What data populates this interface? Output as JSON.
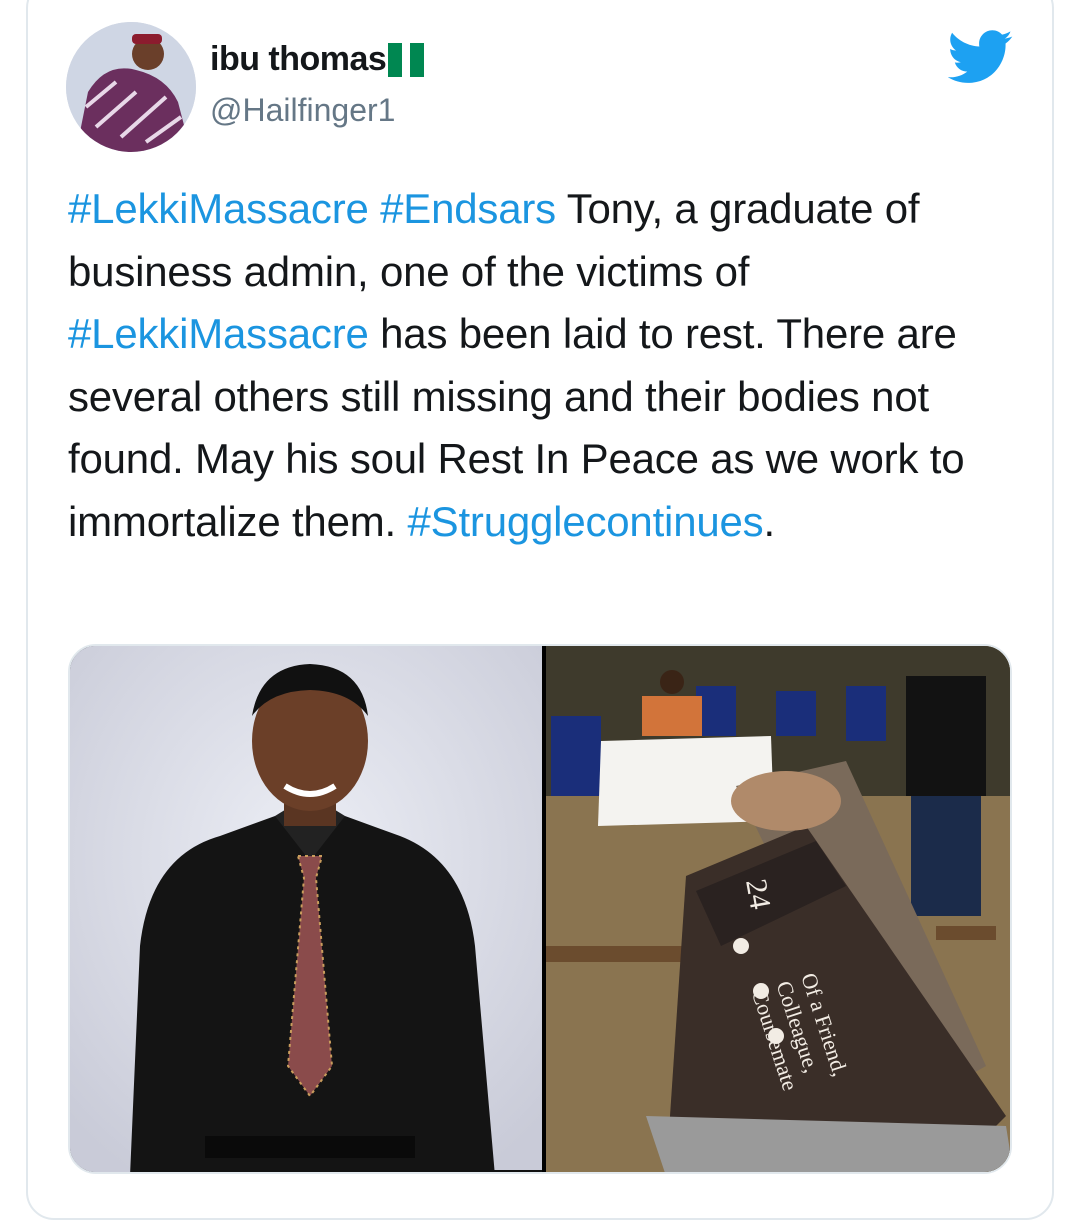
{
  "author": {
    "display_name": "ibu thomas",
    "handle": "@Hailfinger1"
  },
  "icons": {
    "flag": "nigeria-flag-icon",
    "brand": "twitter-bird-icon"
  },
  "tweet": {
    "segments": [
      {
        "text": "#LekkiMassacre",
        "type": "hashtag"
      },
      {
        "text": " ",
        "type": "text"
      },
      {
        "text": "#Endsars",
        "type": "hashtag"
      },
      {
        "text": " Tony, a graduate of business admin, one of the victims of ",
        "type": "text"
      },
      {
        "text": "#LekkiMassacre",
        "type": "hashtag"
      },
      {
        "text": " has been laid to rest. There are several others still missing and their bodies not found. May his soul Rest In Peace as we work to immortalize them. ",
        "type": "text"
      },
      {
        "text": "#Strugglecontinues",
        "type": "hashtag"
      },
      {
        "text": ".",
        "type": "text"
      }
    ]
  },
  "media": {
    "coffin_texts": [
      "24",
      "Of a Friend,",
      "Colleague,",
      "Coursemate"
    ]
  },
  "colors": {
    "link": "#1b95e0",
    "text": "#14171a",
    "muted": "#657786",
    "twitter_blue": "#1da1f2"
  }
}
